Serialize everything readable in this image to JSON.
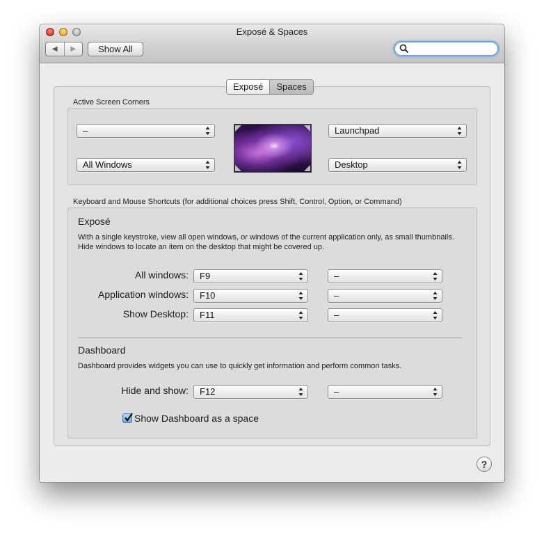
{
  "window": {
    "title": "Exposé & Spaces",
    "nav_back_icon": "triangle-left-icon",
    "nav_forward_icon": "triangle-right-icon",
    "show_all_label": "Show All",
    "search": {
      "value": "",
      "placeholder": ""
    }
  },
  "tabs": [
    {
      "label": "Exposé",
      "selected": true
    },
    {
      "label": "Spaces",
      "selected": false
    }
  ],
  "corners": {
    "section_label": "Active Screen Corners",
    "top_left": "–",
    "top_right": "Launchpad",
    "bottom_left": "All Windows",
    "bottom_right": "Desktop"
  },
  "shortcuts": {
    "section_label": "Keyboard and Mouse Shortcuts (for additional choices press Shift, Control, Option, or Command)",
    "expose": {
      "heading": "Exposé",
      "description": "With a single keystroke, view all open windows, or windows of the current application only, as small thumbnails. Hide windows to locate an item on the desktop that might be covered up.",
      "rows": [
        {
          "label": "All windows:",
          "key": "F9",
          "mouse": "–"
        },
        {
          "label": "Application windows:",
          "key": "F10",
          "mouse": "–"
        },
        {
          "label": "Show Desktop:",
          "key": "F11",
          "mouse": "–"
        }
      ]
    },
    "dashboard": {
      "heading": "Dashboard",
      "description": "Dashboard provides widgets you can use to quickly get information and perform common tasks.",
      "row": {
        "label": "Hide and show:",
        "key": "F12",
        "mouse": "–"
      },
      "show_as_space_label": "Show Dashboard as a space",
      "show_as_space_checked": true
    }
  },
  "help_label": "?",
  "colors": {
    "search_focus": "#6ea3e6",
    "checkbox_fill": "#6fa3e0",
    "close_button": "#e0443a",
    "minimize_button": "#f0b23a"
  }
}
